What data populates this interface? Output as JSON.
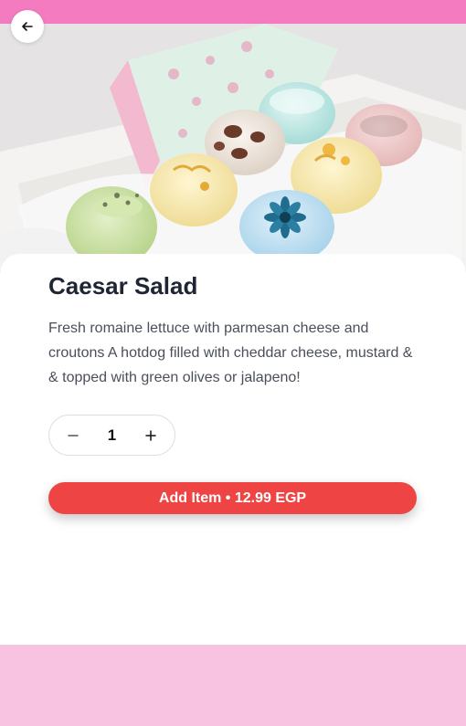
{
  "product": {
    "image_alt": "Box of pastel cupcake-shaped bath bombs",
    "title": "Caesar Salad",
    "description": "Fresh romaine lettuce with parmesan cheese and croutons A hotdog filled with cheddar cheese, mustard & & topped with green olives or jalapeno!"
  },
  "quantity": {
    "value": "1",
    "decrement_icon": "minus-icon",
    "increment_icon": "plus-icon"
  },
  "cart": {
    "add_label": "Add Item • 12.99 EGP"
  },
  "icons": {
    "back": "arrow-left-icon"
  },
  "colors": {
    "top_bar": "#f47bbf",
    "page_background": "#f8c3e0",
    "accent": "#ef4444",
    "title_text": "#1f2533"
  }
}
